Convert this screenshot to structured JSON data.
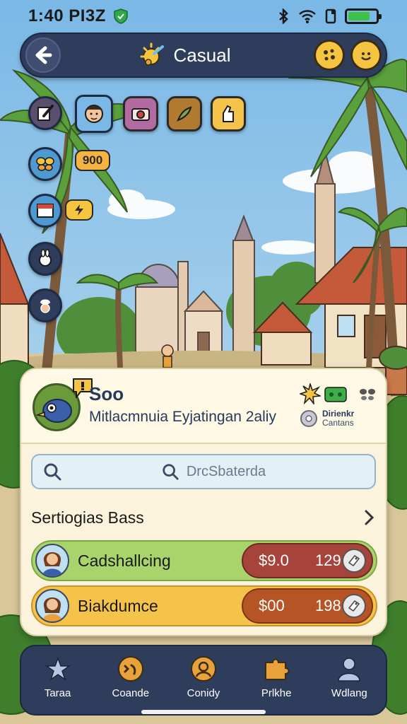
{
  "status_bar": {
    "time": "1:40 PI3Z",
    "icons": [
      "shield-icon",
      "bluetooth-icon",
      "wifi-icon",
      "sim-icon",
      "battery-icon"
    ],
    "battery_level": 0.8
  },
  "header": {
    "title": "Casual",
    "icons": [
      "back-arrow-icon",
      "sun-compass-icon",
      "cookie-coin-icon",
      "smile-coin-icon"
    ]
  },
  "tools": {
    "badge_1": "900",
    "icons": [
      "note-pencil-icon",
      "face-portrait-icon",
      "camera-icon",
      "feather-icon",
      "glove-icon",
      "butterfly-icon",
      "calendar-icon",
      "lightning-icon",
      "rabbit-icon",
      "chef-hat-icon"
    ]
  },
  "profile": {
    "name": "Soo",
    "subtitle": "Mitlacmnuia Eyjatingan 2aliy",
    "status_title": "Dirienkr",
    "status_sub": "Cantans",
    "icons": [
      "bird-mascot-icon",
      "speech-badge-icon",
      "burst-icon",
      "green-ticket-icon",
      "butterfly-icon",
      "gear-circle-icon"
    ]
  },
  "search": {
    "placeholder": "DrcSbaterda"
  },
  "section": {
    "title": "Sertiogias Bass"
  },
  "rows": [
    {
      "label": "Cadshallcing",
      "price": "$9.0",
      "count": "129",
      "color": "#a9d36b"
    },
    {
      "label": "Biakdumce",
      "price": "$00",
      "count": "198",
      "color": "#f6c34a"
    }
  ],
  "nav": [
    {
      "label": "Taraa",
      "icon": "star-icon"
    },
    {
      "label": "Coande",
      "icon": "gamepad-icon"
    },
    {
      "label": "Conidy",
      "icon": "face-icon"
    },
    {
      "label": "Prlkhe",
      "icon": "puzzle-icon"
    },
    {
      "label": "Wdlang",
      "icon": "person-icon"
    }
  ],
  "colors": {
    "bar_navy": "#2f3d5c",
    "panel_cream": "#fbf3dc",
    "row_green": "#a9d36b",
    "row_orange": "#f6c34a",
    "chip_red": "#a6433a",
    "chip_brown": "#b65426"
  }
}
